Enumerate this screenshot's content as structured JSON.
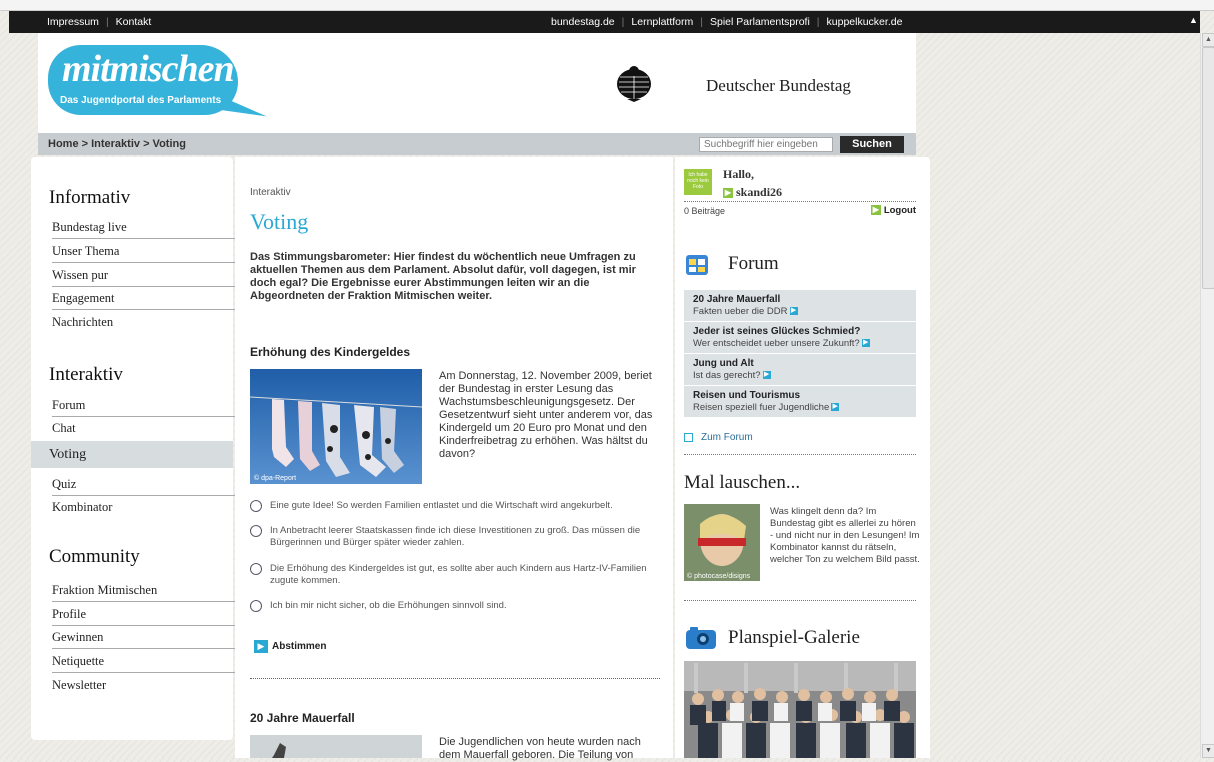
{
  "topbar": {
    "left_links": [
      "Impressum",
      "Kontakt"
    ],
    "right_links": [
      "bundestag.de",
      "Lernplattform",
      "Spiel Parlamentsprofi",
      "kuppelkucker.de"
    ]
  },
  "header": {
    "logo_text": "mitmischen",
    "logo_sub": "Das Jugendportal des Parlaments",
    "org_name": "Deutscher Bundestag"
  },
  "breadcrumb": "Home > Interaktiv > Voting",
  "search": {
    "placeholder": "Suchbegriff hier eingeben",
    "button": "Suchen"
  },
  "nav": {
    "sections": [
      {
        "title": "Informativ",
        "items": [
          "Bundestag live",
          "Unser Thema",
          "Wissen pur",
          "Engagement",
          "Nachrichten"
        ]
      },
      {
        "title": "Interaktiv",
        "items": [
          "Forum",
          "Chat",
          "Voting",
          "Quiz",
          "Kombinator"
        ]
      },
      {
        "title": "Community",
        "items": [
          "Fraktion Mitmischen",
          "Profile",
          "Gewinnen",
          "Netiquette",
          "Newsletter"
        ]
      }
    ],
    "active": "Voting"
  },
  "main": {
    "section_label": "Interaktiv",
    "title": "Voting",
    "intro": "Das Stimmungsbarometer: Hier findest du wöchentlich neue Umfragen zu aktuellen Themen aus dem Parlament. Absolut dafür, voll dagegen, ist mir doch egal? Die Ergebnisse eurer Abstimmungen leiten wir an die Abgeordneten der Fraktion Mitmischen weiter.",
    "article1": {
      "title": "Erhöhung des Kindergeldes",
      "image_credit": "© dpa-Report",
      "text": "Am Donnerstag, 12. November 2009, beriet der Bundestag in erster Lesung das Wachstumsbeschleunigungsgesetz. Der Gesetzentwurf sieht unter anderem vor, das Kindergeld um 20 Euro pro Monat und den Kinderfreibetrag zu erhöhen. Was hältst du davon?",
      "options": [
        "Eine gute Idee! So werden Familien entlastet und die Wirtschaft wird angekurbelt.",
        "In Anbetracht leerer Staatskassen finde ich diese Investitionen zu groß. Das müssen die Bürgerinnen und Bürger später wieder zahlen.",
        "Die Erhöhung des Kindergeldes ist gut, es sollte aber auch Kindern aus Hartz-IV-Familien zugute kommen.",
        "Ich bin mir nicht sicher, ob die Erhöhungen sinnvoll sind."
      ],
      "vote_button": "Abstimmen"
    },
    "article2": {
      "title": "20 Jahre Mauerfall",
      "text": "Die Jugendlichen von heute wurden nach dem Mauerfall geboren. Die Teilung von"
    }
  },
  "sidebar": {
    "avatar_text": "Ich habe noch kein Foto",
    "greeting": "Hallo,",
    "username": "skandi26",
    "posts": "0 Beiträge",
    "logout": "Logout",
    "forum": {
      "title": "Forum",
      "items": [
        {
          "title": "20 Jahre Mauerfall",
          "sub": "Fakten ueber die DDR"
        },
        {
          "title": "Jeder ist seines Glückes Schmied?",
          "sub": "Wer entscheidet ueber unsere Zukunft?"
        },
        {
          "title": "Jung und Alt",
          "sub": "Ist das gerecht?"
        },
        {
          "title": "Reisen und Tourismus",
          "sub": "Reisen speziell fuer Jugendliche"
        }
      ],
      "link": "Zum Forum"
    },
    "lauschen": {
      "title": "Mal lauschen...",
      "image_credit": "© photocase/disigns",
      "text": "Was klingelt denn da? Im Bundestag gibt es allerlei zu hören - und nicht nur in den Lesungen! Im Kombinator kannst du rätseln, welcher Ton zu welchem Bild passt."
    },
    "galerie": {
      "title": "Planspiel-Galerie"
    }
  },
  "colors": {
    "accent": "#2aa8d4",
    "logo": "#36b3da",
    "topbar": "#1a1a1a",
    "nav_active": "#d7dcdf",
    "green": "#8ac43f"
  }
}
